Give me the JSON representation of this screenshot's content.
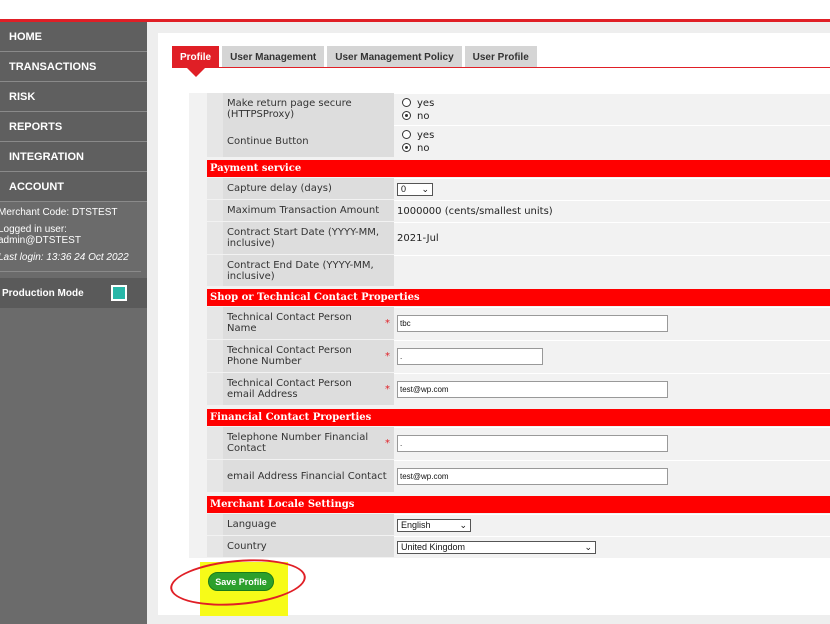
{
  "nav": [
    {
      "label": "HOME"
    },
    {
      "label": "TRANSACTIONS"
    },
    {
      "label": "RISK"
    },
    {
      "label": "REPORTS"
    },
    {
      "label": "INTEGRATION"
    },
    {
      "label": "ACCOUNT"
    }
  ],
  "sidebar_info": {
    "merchant": "Merchant Code: DTSTEST",
    "logged_label": "Logged in user:",
    "logged_user": "admin@DTSTEST",
    "last_login": "Last login: 13:36 24 Oct 2022"
  },
  "production_mode": {
    "label": "Production Mode",
    "color": "#28b7a8"
  },
  "tabs": [
    {
      "label": "Profile"
    },
    {
      "label": "User Management"
    },
    {
      "label": "User Management Policy"
    },
    {
      "label": "User Profile"
    }
  ],
  "rows": {
    "secure": {
      "label": "Make return page secure (HTTPSProxy)",
      "opt_yes": "yes",
      "opt_no": "no"
    },
    "continue": {
      "label": "Continue Button",
      "opt_yes": "yes",
      "opt_no": "no"
    },
    "capture": {
      "label": "Capture delay (days)",
      "value": "0"
    },
    "max_amount": {
      "label": "Maximum Transaction Amount",
      "value": "1000000 (cents/smallest units)"
    },
    "contract_start": {
      "label": "Contract Start Date (YYYY-MM, inclusive)",
      "value": "2021-Jul"
    },
    "contract_end": {
      "label": "Contract End Date (YYYY-MM, inclusive)",
      "value": ""
    },
    "tech_name": {
      "label": "Technical Contact Person Name",
      "value": "tbc"
    },
    "tech_phone": {
      "label": "Technical Contact Person Phone Number",
      "value": "."
    },
    "tech_email": {
      "label": "Technical Contact Person email Address",
      "value": "test@wp.com"
    },
    "fin_phone": {
      "label": "Telephone Number Financial Contact",
      "value": "."
    },
    "fin_email": {
      "label": "email Address Financial Contact",
      "value": "test@wp.com"
    },
    "language": {
      "label": "Language",
      "value": "English"
    },
    "country": {
      "label": "Country",
      "value": "United Kingdom"
    }
  },
  "sections": {
    "payment": "Payment service",
    "shop": "Shop or Technical Contact Properties",
    "financial": "Financial Contact Properties",
    "locale": "Merchant Locale Settings"
  },
  "required_mark": "*",
  "save_label": "Save Profile",
  "colors": {
    "accent": "#e01f26",
    "section": "#ff0000",
    "save": "#2ca02c",
    "highlight": "#f7fb18"
  }
}
